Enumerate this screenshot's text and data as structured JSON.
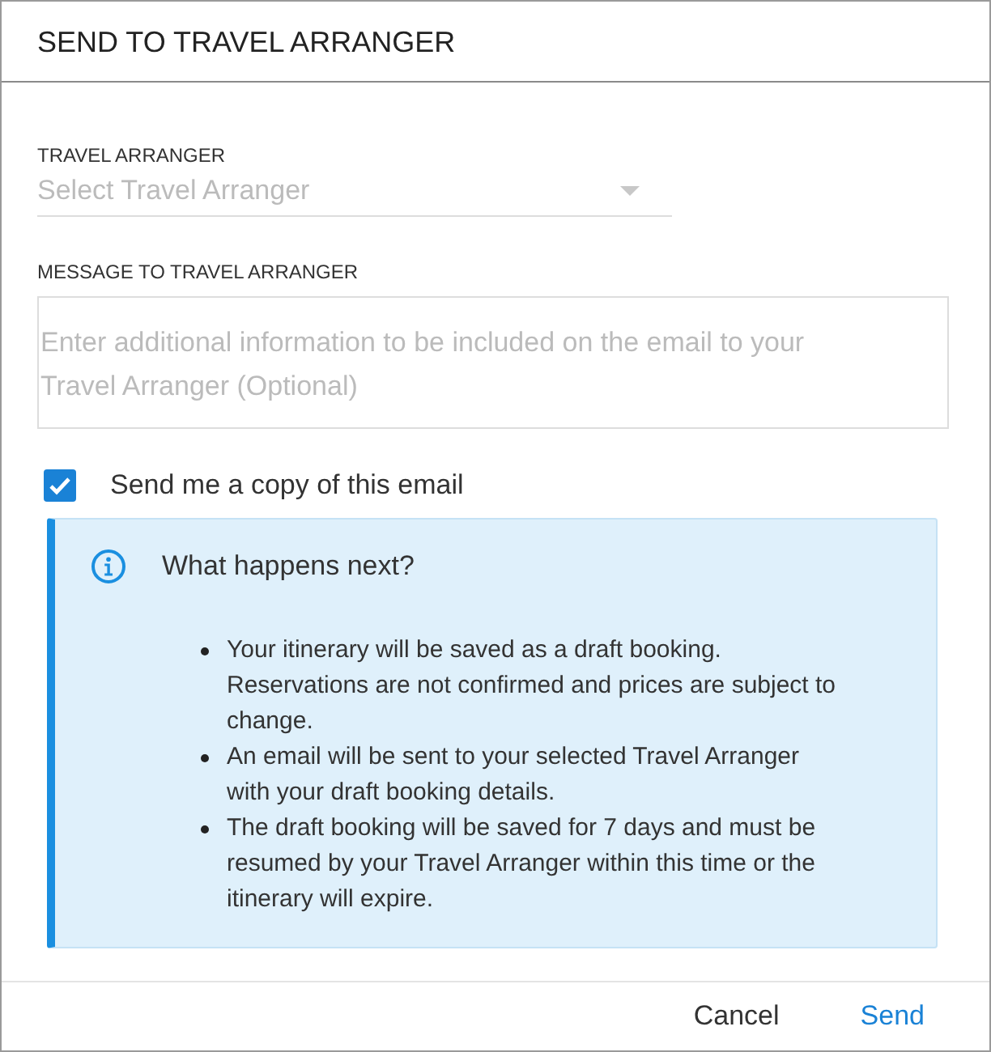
{
  "dialog": {
    "title": "SEND TO TRAVEL ARRANGER"
  },
  "arranger_select": {
    "label": "TRAVEL ARRANGER",
    "placeholder": "Select Travel Arranger"
  },
  "message": {
    "label": "MESSAGE TO TRAVEL ARRANGER",
    "placeholder": "Enter additional information to be included on the email to your Travel Arranger (Optional)"
  },
  "copy_checkbox": {
    "label": "Send me a copy of this email",
    "checked": true
  },
  "info": {
    "title": "What happens next?",
    "items": [
      "Your itinerary will be saved as a draft booking. Reservations are not confirmed and prices are subject to change.",
      "An email will be sent to your selected Travel Arranger with your draft booking details.",
      "The draft booking will be saved for 7 days and must be resumed by your Travel Arranger within this time or the itinerary will expire."
    ]
  },
  "buttons": [
    {
      "label": "Cancel",
      "kind": "secondary"
    },
    {
      "label": "Send",
      "kind": "primary"
    }
  ]
}
